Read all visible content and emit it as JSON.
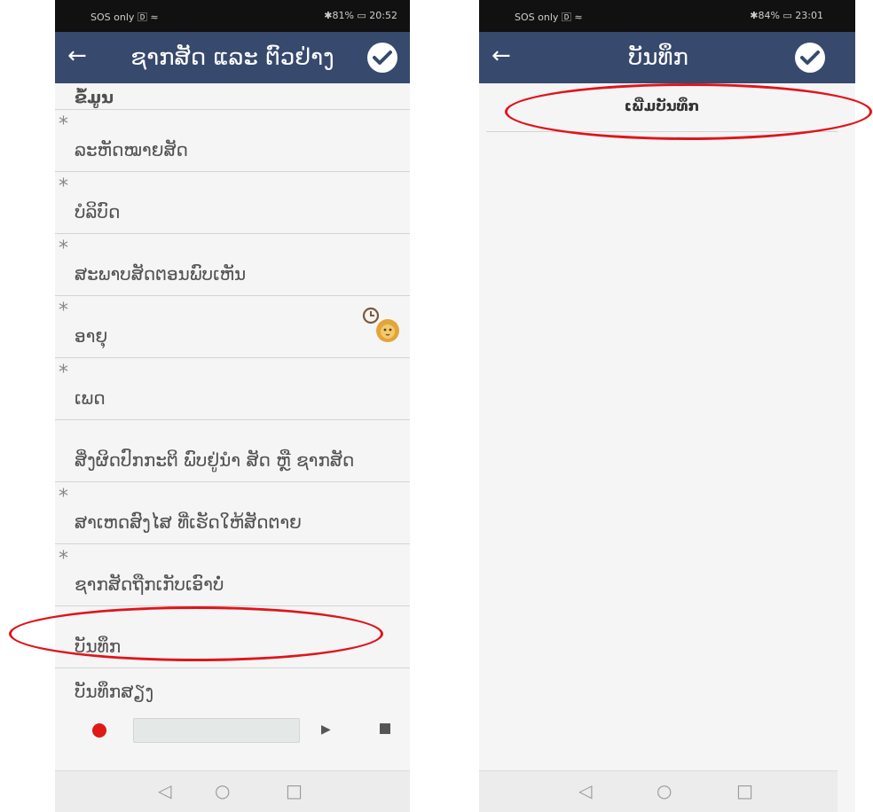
{
  "left_screen": {
    "status": {
      "left": "SOS only 🄳 ≈",
      "right": "✱81% ▭ 20:52"
    },
    "appbar": {
      "back_icon": "←",
      "title": "ຊາກສັດ ແລະ ຕົວຢ່າງ"
    },
    "partial_label": "ຂໍ້ມູນ",
    "items": [
      {
        "label": "ລະຫັດໝາຍສັດ",
        "required": "*"
      },
      {
        "label": "ບໍລິບົດ",
        "required": "*"
      },
      {
        "label": "ສະພາບສັດຕອນພົບເຫັນ",
        "required": "*"
      },
      {
        "label": "ອາຍຸ",
        "required": "*"
      },
      {
        "label": "ເພດ",
        "required": "*"
      },
      {
        "label": "ສິ່ງຜິດປົກກະຕິ ພົບຢູ່ນຳ ສັດ ຫຼື ຊາກສັດ",
        "required": ""
      },
      {
        "label": "ສາເຫດສົງໄສ ທີ່ເຮັດໃຫ້ສັດຕາຍ",
        "required": "*"
      },
      {
        "label": "ຊາກສັດຖືກເກັບເອົາບໍ່",
        "required": "*"
      },
      {
        "label": "ບັນທຶກ",
        "required": ""
      },
      {
        "label": "ບັນທຶກສຽງ",
        "required": ""
      }
    ],
    "nav": {
      "back": "◁",
      "home": "○",
      "recent": "□"
    }
  },
  "right_screen": {
    "status": {
      "left": "SOS only 🄳 ≈",
      "right": "✱84% ▭ 23:01"
    },
    "appbar": {
      "back_icon": "←",
      "title": "ບັນທຶກ"
    },
    "add_note": "ເພີ່ມບັນທຶກ",
    "nav": {
      "back": "◁",
      "home": "○",
      "recent": "□"
    }
  },
  "colors": {
    "appbar": "#37496d",
    "highlight": "#e0141a",
    "record": "#e11818"
  }
}
